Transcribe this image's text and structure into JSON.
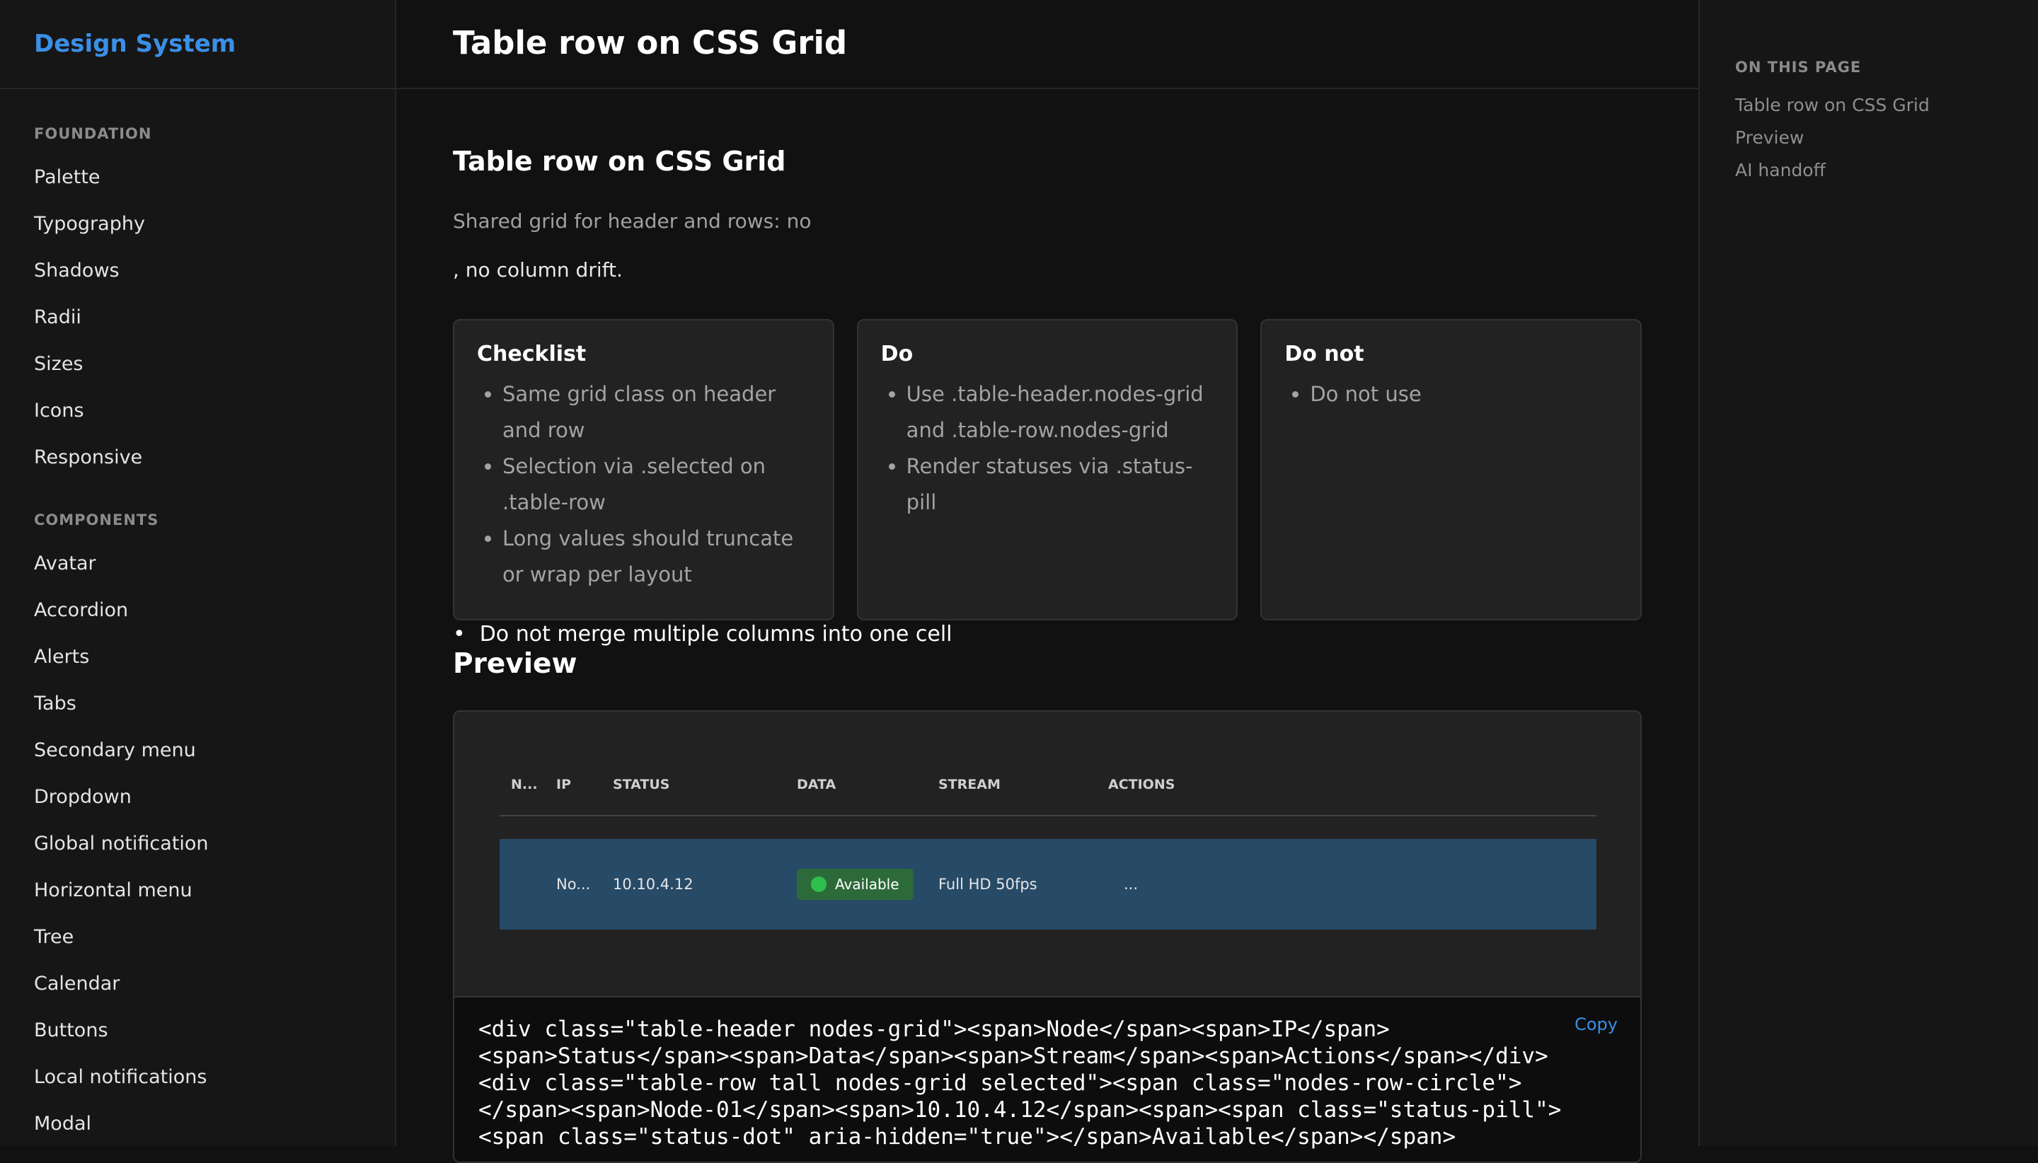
{
  "brand": "Design System",
  "sidebar": {
    "sections": [
      {
        "heading": "FOUNDATION",
        "items": [
          "Palette",
          "Typography",
          "Shadows",
          "Radii",
          "Sizes",
          "Icons",
          "Responsive"
        ]
      },
      {
        "heading": "COMPONENTS",
        "items": [
          "Avatar",
          "Accordion",
          "Alerts",
          "Tabs",
          "Secondary menu",
          "Dropdown",
          "Global notification",
          "Horizontal menu",
          "Tree",
          "Calendar",
          "Buttons",
          "Local notifications",
          "Modal"
        ]
      }
    ]
  },
  "page": {
    "title": "Table row on CSS Grid",
    "section_title": "Table row on CSS Grid",
    "lead": "Shared grid for header and rows: no",
    "lead_continued": ", no column drift.",
    "cards": [
      {
        "title": "Checklist",
        "items": [
          "Same grid class on header and row",
          "Selection via .selected on .table-row",
          "Long values should truncate or wrap per layout"
        ]
      },
      {
        "title": "Do",
        "items": [
          "Use .table-header.nodes-grid and .table-row.nodes-grid",
          "Render statuses via .status-pill"
        ]
      },
      {
        "title": "Do not",
        "items": [
          "Do not use"
        ]
      }
    ],
    "outside_item": "Do not merge multiple columns into one cell",
    "preview_title": "Preview"
  },
  "preview": {
    "headers": [
      "N...",
      "IP",
      "STATUS",
      "DATA",
      "STREAM",
      "ACTIONS"
    ],
    "row": {
      "node": "No...",
      "ip": "10.10.4.12",
      "status": "Available",
      "stream": "Full HD 50fps",
      "actions": "..."
    },
    "copy_label": "Copy",
    "code": "<div class=\"table-header nodes-grid\"><span>Node</span><span>IP</span>\n<span>Status</span><span>Data</span><span>Stream</span><span>Actions</span></div>\n<div class=\"table-row tall nodes-grid selected\"><span class=\"nodes-row-circle\">\n</span><span>Node-01</span><span>10.10.4.12</span><span><span class=\"status-pill\">\n<span class=\"status-dot\" aria-hidden=\"true\"></span>Available</span></span>"
  },
  "toc": {
    "heading": "ON THIS PAGE",
    "items": [
      "Table row on CSS Grid",
      "Preview",
      "AI handoff"
    ]
  },
  "colors": {
    "accent": "#3b8fe6",
    "selected_row": "#274a67",
    "status_available": "#2fbf4f"
  }
}
